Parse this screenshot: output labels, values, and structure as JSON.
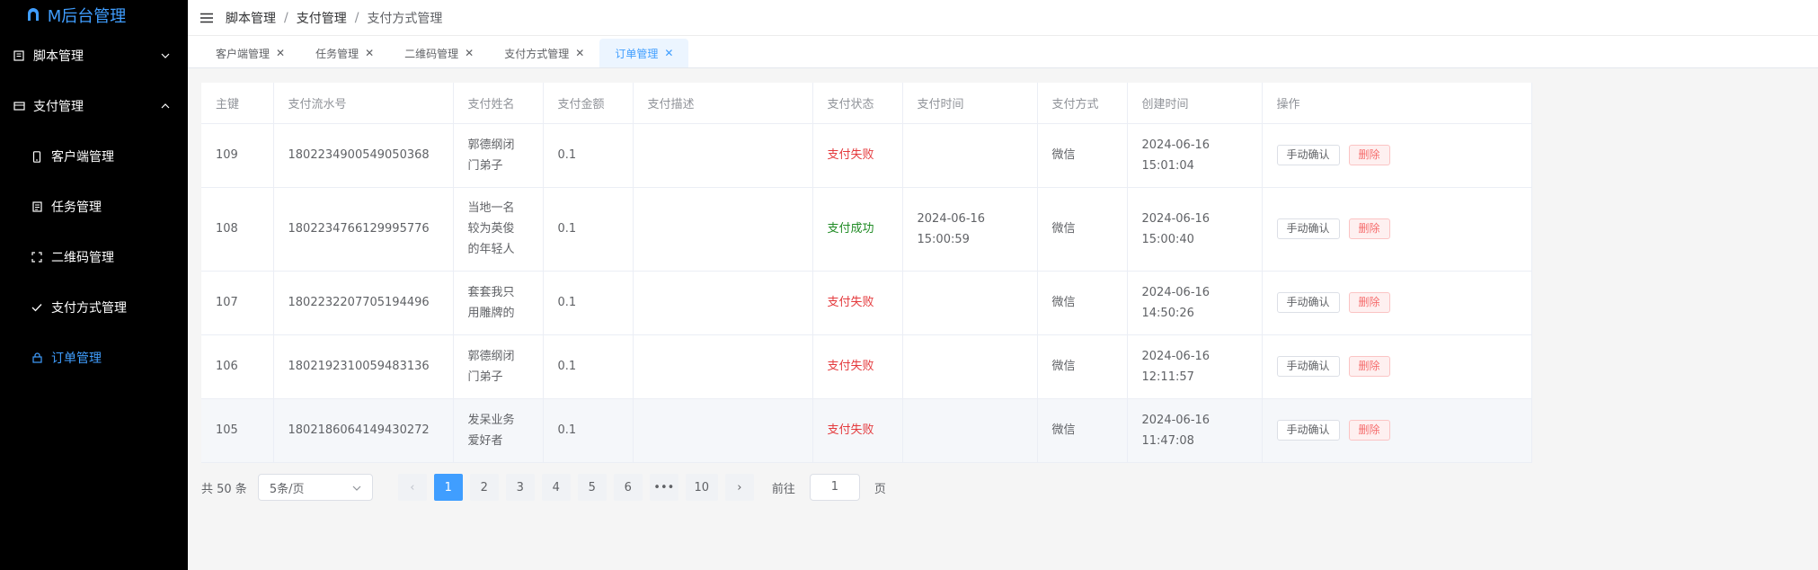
{
  "app": {
    "title": "M后台管理"
  },
  "sidebar": {
    "items": [
      {
        "label": "脚本管理",
        "icon": "script-icon",
        "expanded": false
      },
      {
        "label": "支付管理",
        "icon": "payment-icon",
        "expanded": true
      }
    ],
    "sub_items": [
      {
        "label": "客户端管理",
        "icon": "phone-icon"
      },
      {
        "label": "任务管理",
        "icon": "task-icon"
      },
      {
        "label": "二维码管理",
        "icon": "qrcode-icon"
      },
      {
        "label": "支付方式管理",
        "icon": "check-icon"
      },
      {
        "label": "订单管理",
        "icon": "lock-icon",
        "active": true
      }
    ]
  },
  "breadcrumb": [
    "脚本管理",
    "支付管理",
    "支付方式管理"
  ],
  "tabs": [
    {
      "label": "客户端管理"
    },
    {
      "label": "任务管理"
    },
    {
      "label": "二维码管理"
    },
    {
      "label": "支付方式管理"
    },
    {
      "label": "订单管理",
      "active": true
    }
  ],
  "table": {
    "columns": [
      "主键",
      "支付流水号",
      "支付姓名",
      "支付金额",
      "支付描述",
      "支付状态",
      "支付时间",
      "支付方式",
      "创建时间",
      "操作"
    ],
    "rows": [
      {
        "id": "109",
        "serial": "1802234900549050368",
        "name_l1": "郭德纲闭",
        "name_l2": "门弟子",
        "name_l3": "",
        "amount": "0.1",
        "desc": "",
        "status": "支付失败",
        "pay_d": "",
        "pay_t": "",
        "method": "微信",
        "create_d": "2024-06-16",
        "create_t": "15:01:04"
      },
      {
        "id": "108",
        "serial": "1802234766129995776",
        "name_l1": "当地一名",
        "name_l2": "较为英俊",
        "name_l3": "的年轻人",
        "amount": "0.1",
        "desc": "",
        "status": "支付成功",
        "pay_d": "2024-06-16",
        "pay_t": "15:00:59",
        "method": "微信",
        "create_d": "2024-06-16",
        "create_t": "15:00:40"
      },
      {
        "id": "107",
        "serial": "1802232207705194496",
        "name_l1": "套套我只",
        "name_l2": "用雕牌的",
        "name_l3": "",
        "amount": "0.1",
        "desc": "",
        "status": "支付失败",
        "pay_d": "",
        "pay_t": "",
        "method": "微信",
        "create_d": "2024-06-16",
        "create_t": "14:50:26"
      },
      {
        "id": "106",
        "serial": "1802192310059483136",
        "name_l1": "郭德纲闭",
        "name_l2": "门弟子",
        "name_l3": "",
        "amount": "0.1",
        "desc": "",
        "status": "支付失败",
        "pay_d": "",
        "pay_t": "",
        "method": "微信",
        "create_d": "2024-06-16",
        "create_t": "12:11:57"
      },
      {
        "id": "105",
        "serial": "1802186064149430272",
        "name_l1": "发呆业务",
        "name_l2": "爱好者",
        "name_l3": "",
        "amount": "0.1",
        "desc": "",
        "status": "支付失败",
        "pay_d": "",
        "pay_t": "",
        "method": "微信",
        "create_d": "2024-06-16",
        "create_t": "11:47:08"
      }
    ],
    "actions": {
      "confirm": "手动确认",
      "delete": "删除"
    }
  },
  "pagination": {
    "total_text": "共 50 条",
    "page_size": "5条/页",
    "pages": [
      "1",
      "2",
      "3",
      "4",
      "5",
      "6",
      "•••",
      "10"
    ],
    "current_page": "1",
    "goto_label": "前往",
    "goto_value": "1",
    "goto_suffix": "页"
  },
  "colors": {
    "accent": "#409eff",
    "fail": "#e4393c",
    "success": "#1f8b24"
  }
}
